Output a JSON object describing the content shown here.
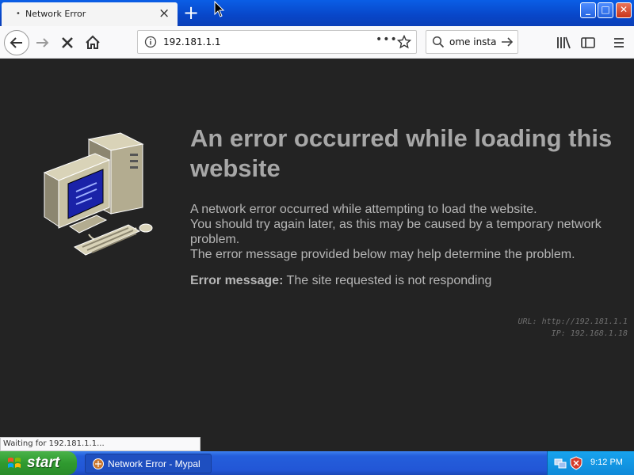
{
  "browser": {
    "tab": {
      "title": "Network Error",
      "dot": "•"
    },
    "new_tab_label": "+",
    "window_buttons": {
      "minimize": "_",
      "maximize": "□",
      "close": "✕"
    },
    "url": "192.181.1.1",
    "search_text": "ome insta",
    "status_text": "Waiting for 192.181.1.1..."
  },
  "page": {
    "heading": "An error occurred while loading this website",
    "paragraph_1": "A network error occurred while attempting to load the website.",
    "paragraph_2": "You should try again later, as this may be caused by a temporary network problem.",
    "paragraph_3": "The error message provided below may help determine the problem.",
    "error_label": "Error message:",
    "error_text": "The site requested is not responding",
    "url_line": "URL: http://192.181.1.1",
    "ip_line": "IP: 192.168.1.18"
  },
  "taskbar": {
    "start_label": "start",
    "task_label": "Network Error - Mypal",
    "clock": "9:12 PM"
  },
  "colors": {
    "titlebar": "#0846c8",
    "page_background": "#232323",
    "heading": "#a7a7a7",
    "body_text": "#b6b6b6",
    "start_button": "#2f9a2f",
    "taskbar": "#245edb"
  },
  "icons": [
    "back-arrow-icon",
    "forward-arrow-icon",
    "stop-icon",
    "home-icon",
    "info-icon",
    "page-actions-icon",
    "bookmark-star-icon",
    "search-icon",
    "go-arrow-icon",
    "library-icon",
    "sidebar-icon",
    "menu-icon",
    "computer-illustration",
    "windows-logo-icon",
    "mypal-icon",
    "network-tray-icon",
    "security-shield-icon"
  ]
}
